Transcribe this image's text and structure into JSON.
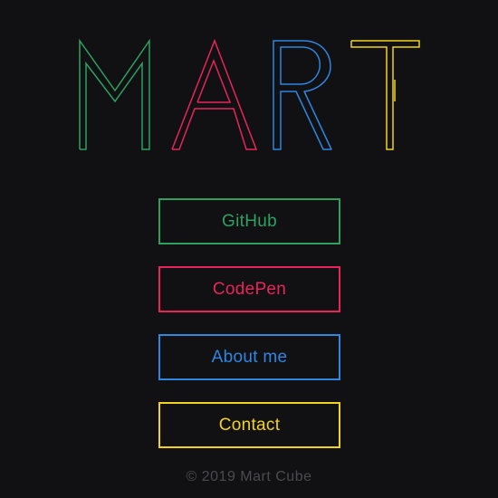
{
  "logo": {
    "text": "MART",
    "letters": [
      {
        "char": "M",
        "color": "#2fa060"
      },
      {
        "char": "A",
        "color": "#e8245a"
      },
      {
        "char": "R",
        "color": "#2e86e0"
      },
      {
        "char": "T",
        "color": "#f3d21a"
      }
    ]
  },
  "nav": [
    {
      "label": "GitHub",
      "color": "#2fa060"
    },
    {
      "label": "CodePen",
      "color": "#e8245a"
    },
    {
      "label": "About me",
      "color": "#2e86e0"
    },
    {
      "label": "Contact",
      "color": "#f3d21a"
    }
  ],
  "footer": {
    "text": "© 2019 Mart Cube",
    "color": "#4a4a50"
  },
  "colors": {
    "background": "#111114"
  }
}
